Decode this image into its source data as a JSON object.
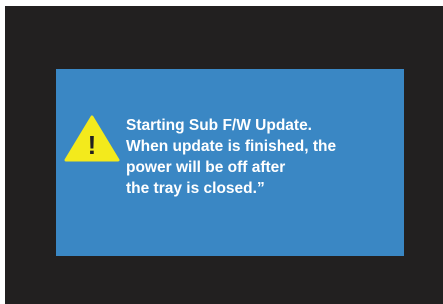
{
  "colors": {
    "screen_background": "#222020",
    "dialog_background": "#3a87c4",
    "warning_fill": "#f3ea1c",
    "warning_mark": "#222020",
    "text": "#ffffff"
  },
  "dialog": {
    "icon": "warning-icon",
    "warning_mark": "!",
    "message_lines": [
      "Starting Sub F/W Update.",
      "When update is finished, the",
      "power will be off after",
      "the tray is closed.”"
    ]
  }
}
